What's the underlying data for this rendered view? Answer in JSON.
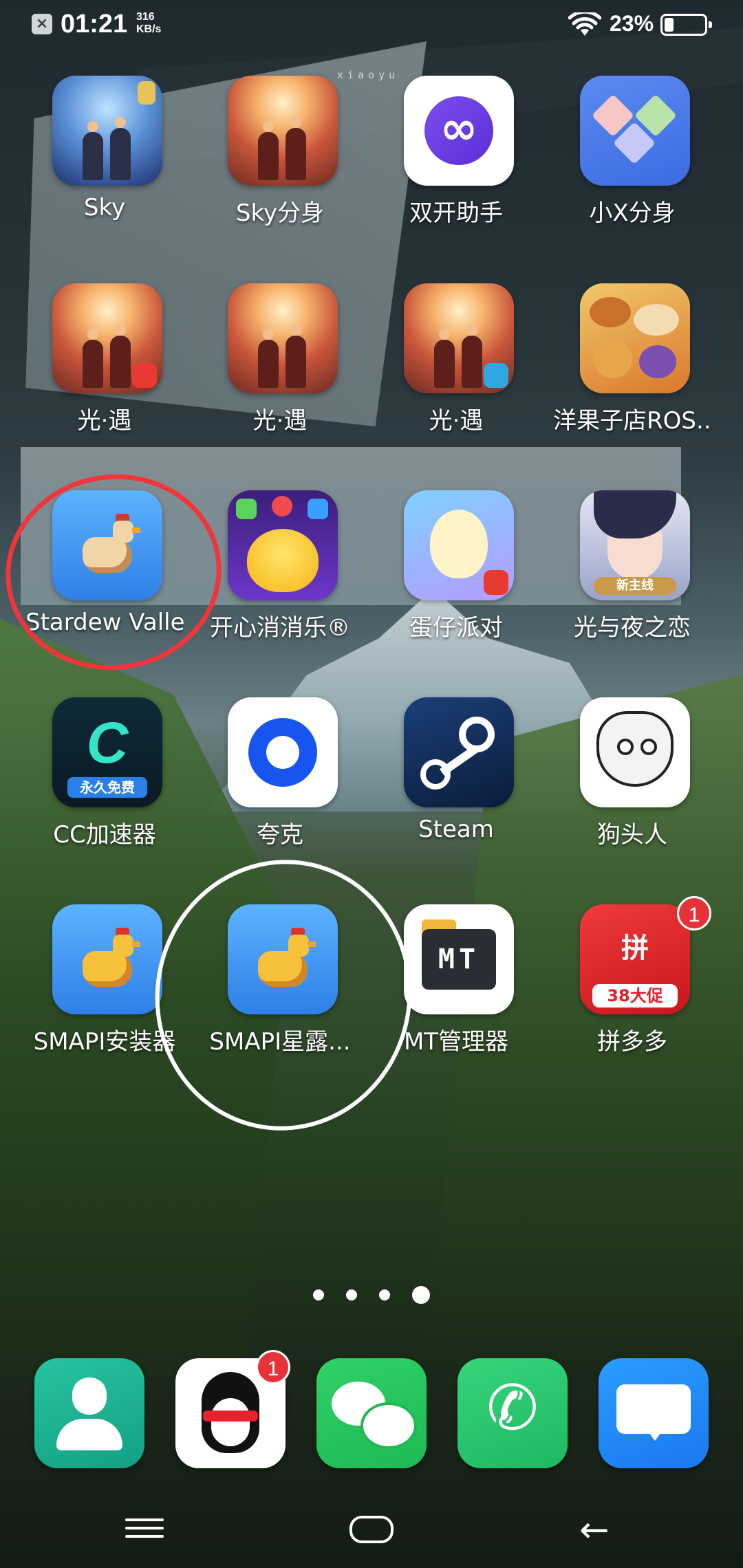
{
  "status_bar": {
    "time": "01:21",
    "net_speed_value": "316",
    "net_speed_unit": "KB/s",
    "battery_percent": "23%",
    "battery_level": 0.23,
    "icons": [
      "notification-x-icon",
      "wifi-icon",
      "battery-icon"
    ]
  },
  "wallpaper": {
    "watermark": "xiaoyu"
  },
  "apps": [
    {
      "label": "Sky"
    },
    {
      "label": "Sky分身"
    },
    {
      "label": "双开助手"
    },
    {
      "label": "小X分身"
    },
    {
      "label": "光·遇"
    },
    {
      "label": "光·遇"
    },
    {
      "label": "光·遇"
    },
    {
      "label": "洋果子店ROS..."
    },
    {
      "label": "Stardew Valley"
    },
    {
      "label": "开心消消乐®"
    },
    {
      "label": "蛋仔派对"
    },
    {
      "label": "光与夜之恋",
      "tag": "新主线"
    },
    {
      "label": "CC加速器",
      "tag": "永久免费"
    },
    {
      "label": "夸克"
    },
    {
      "label": "Steam"
    },
    {
      "label": "狗头人"
    },
    {
      "label": "SMAPI安装器"
    },
    {
      "label": "SMAPI星露..."
    },
    {
      "label": "MT管理器",
      "icon_text": "MT"
    },
    {
      "label": "拼多多",
      "badge": "1",
      "icon_text": "拼",
      "tag": "38大促"
    }
  ],
  "pager": {
    "pages": 4,
    "current": 4
  },
  "dock": {
    "qq_badge": "1",
    "items": [
      "contacts-icon",
      "qq-icon",
      "wechat-icon",
      "phone-icon",
      "messages-icon"
    ]
  },
  "colors": {
    "annotation_red": "#f0363a",
    "annotation_white": "#ffffff",
    "badge_red": "#e8323a"
  }
}
